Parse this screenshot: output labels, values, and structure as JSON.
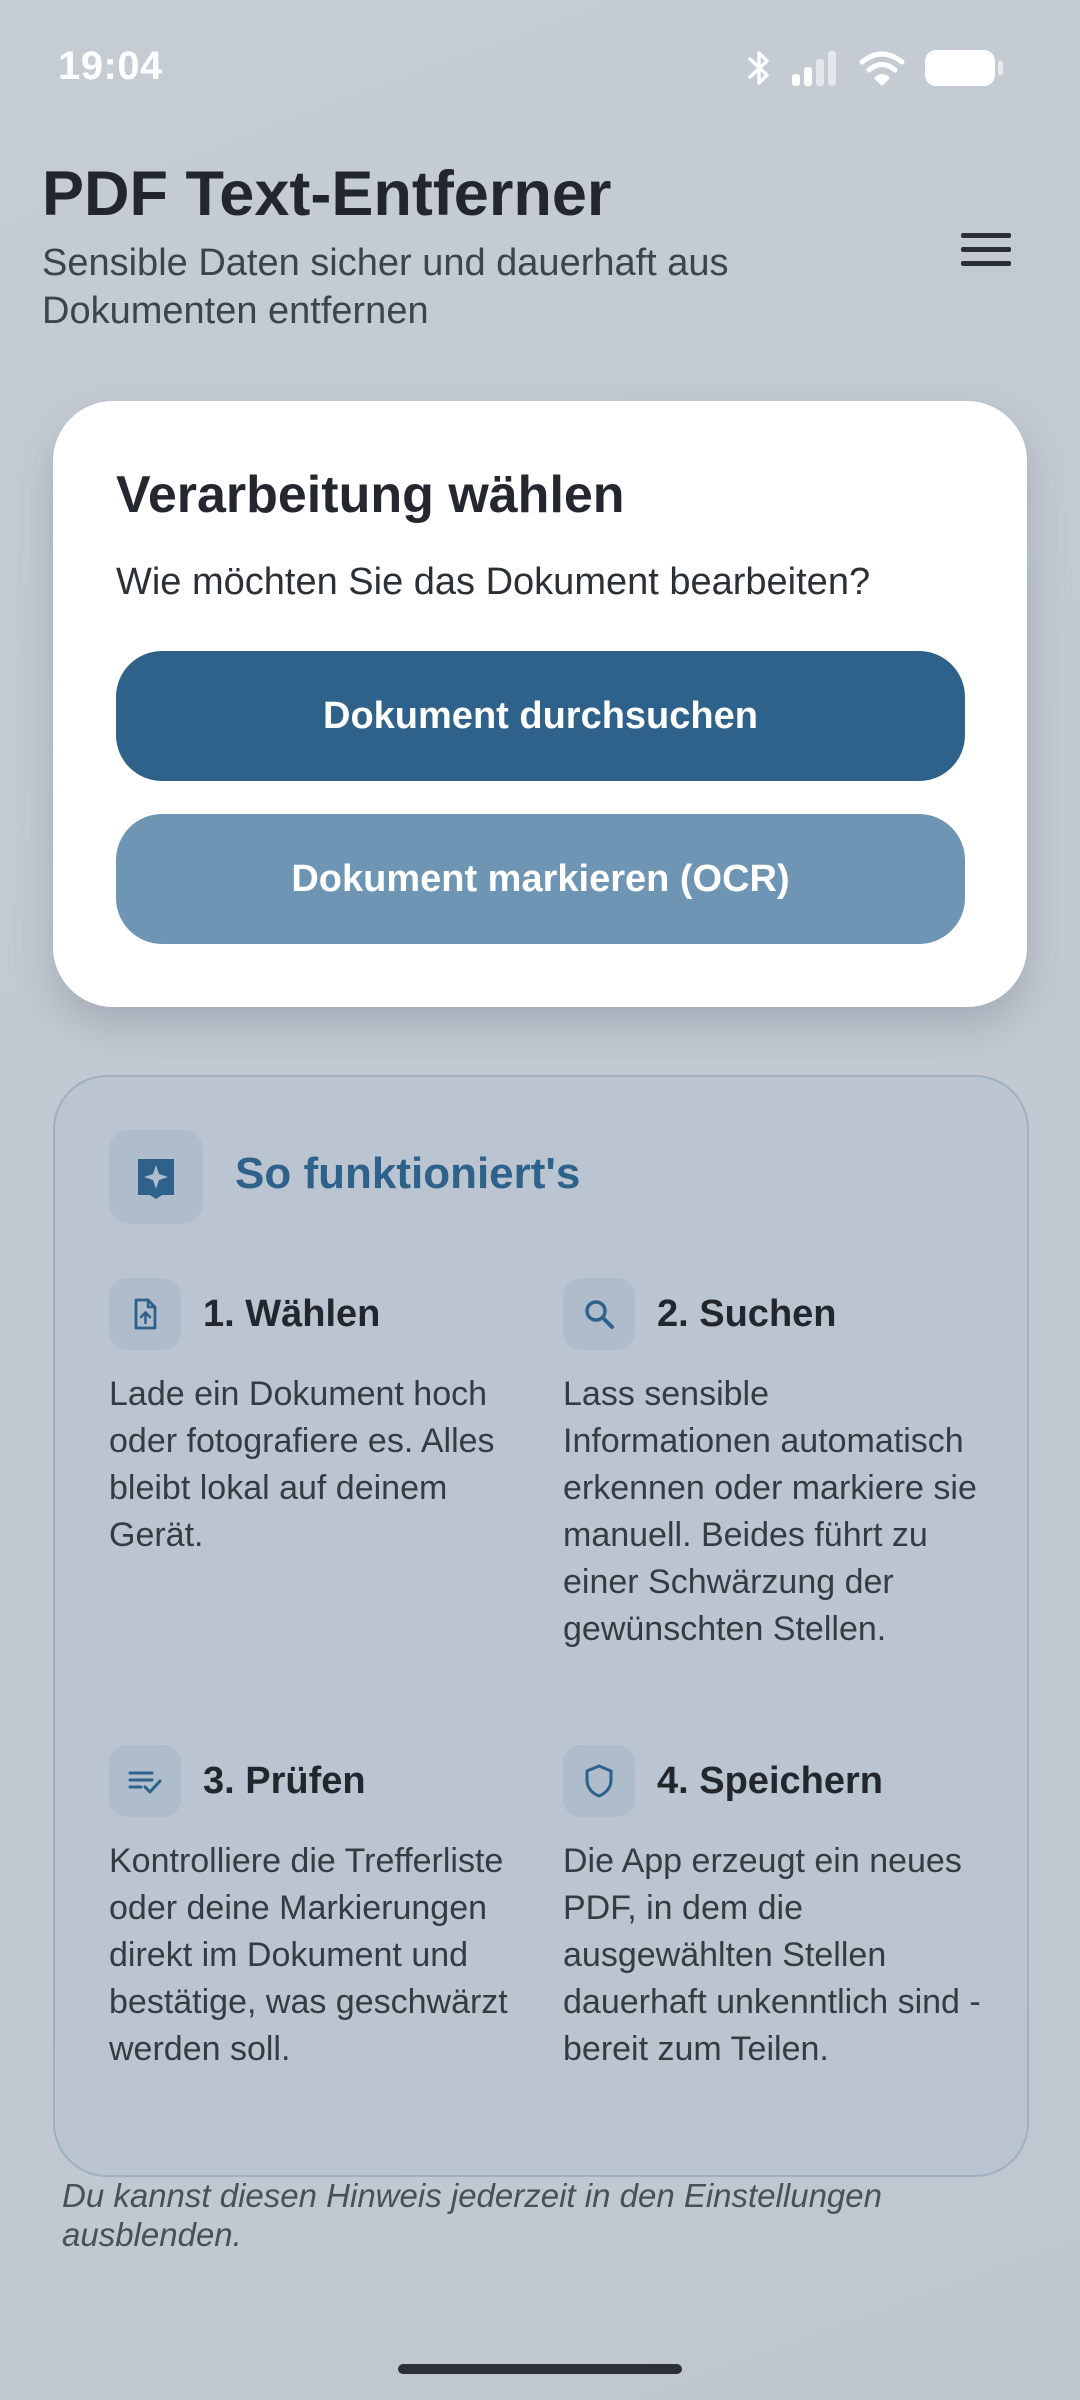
{
  "status_bar": {
    "time": "19:04",
    "icons": [
      "bluetooth-icon",
      "signal-icon",
      "wifi-icon",
      "battery-icon"
    ]
  },
  "header": {
    "title": "PDF Text-Entferner",
    "subtitle": "Sensible Daten sicher und dauerhaft aus Dokumenten entfernen",
    "menu_icon": "hamburger-menu-icon"
  },
  "processing_card": {
    "title": "Verarbeitung wählen",
    "question": "Wie möchten Sie das Dokument bearbeiten?",
    "primary_button": "Dokument durchsuchen",
    "secondary_button": "Dokument markieren (OCR)"
  },
  "howto": {
    "title": "So funktioniert's",
    "icon": "sparkle-icon",
    "steps": [
      {
        "icon": "file-upload-icon",
        "title": "1. Wählen",
        "text": "Lade ein Dokument hoch oder fotografiere es. Alles bleibt lokal auf deinem Gerät."
      },
      {
        "icon": "search-icon",
        "title": "2. Suchen",
        "text": "Lass sensible Informationen automatisch erkennen oder markiere sie manuell. Beides führt zu einer Schwärzung der gewünschten Stellen."
      },
      {
        "icon": "checklist-icon",
        "title": "3. Prüfen",
        "text": "Kontrolliere die Trefferliste oder deine Markierungen direkt im Dokument und bestätige, was geschwärzt werden soll."
      },
      {
        "icon": "shield-icon",
        "title": "4. Speichern",
        "text": "Die App erzeugt ein neues PDF, in dem die ausgewählten Stellen dauerhaft unkenntlich sind - bereit zum Teilen."
      }
    ]
  },
  "hint": "Du kannst diesen Hinweis jederzeit in den Einstellungen ausblenden.",
  "colors": {
    "primary": "#2e628b",
    "secondary": "#6e95b3",
    "background": "#c3c9d2"
  }
}
